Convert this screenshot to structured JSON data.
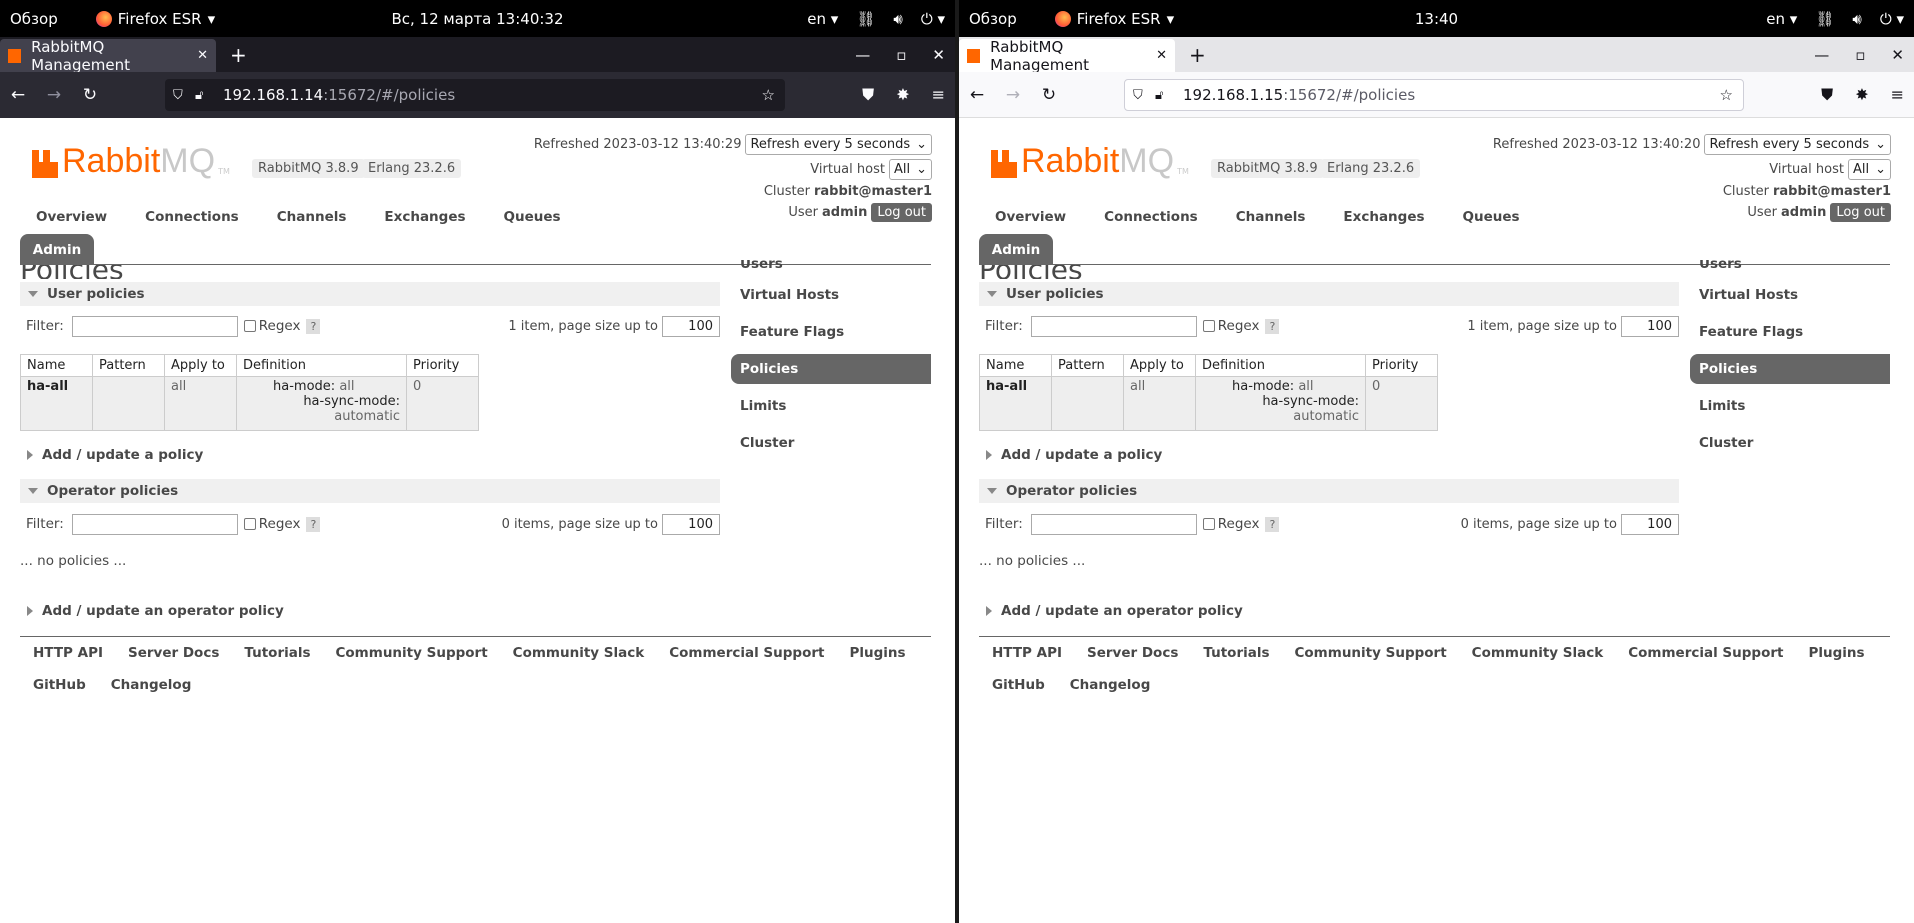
{
  "windows": [
    {
      "gnome": {
        "activities": "Обзор",
        "app": "Firefox ESR",
        "clock": "Вс, 12 марта  13:40:32",
        "lang": "en"
      },
      "tab_title": "RabbitMQ Management",
      "url_host": "192.168.1.14",
      "url_path": ":15672/#/policies",
      "refreshed": "Refreshed 2023-03-12 13:40:29",
      "refresh_option": "Refresh every 5 seconds",
      "vhost_label": "Virtual host",
      "vhost_value": "All",
      "cluster_label": "Cluster",
      "cluster_value": "rabbit@master1",
      "user_label": "User",
      "user_value": "admin",
      "logout": "Log out",
      "version": "RabbitMQ 3.8.9",
      "erlang": "Erlang 23.2.6"
    },
    {
      "gnome": {
        "activities": "Обзор",
        "app": "Firefox ESR",
        "clock": "13:40",
        "lang": "en"
      },
      "tab_title": "RabbitMQ Management",
      "url_host": "192.168.1.15",
      "url_path": ":15672/#/policies",
      "refreshed": "Refreshed 2023-03-12 13:40:20",
      "refresh_option": "Refresh every 5 seconds",
      "vhost_label": "Virtual host",
      "vhost_value": "All",
      "cluster_label": "Cluster",
      "cluster_value": "rabbit@master1",
      "user_label": "User",
      "user_value": "admin",
      "logout": "Log out",
      "version": "RabbitMQ 3.8.9",
      "erlang": "Erlang 23.2.6"
    }
  ],
  "logo": {
    "rabbit": "Rabbit",
    "mq": "MQ",
    "tm": "TM"
  },
  "nav": [
    "Overview",
    "Connections",
    "Channels",
    "Exchanges",
    "Queues"
  ],
  "admin_tab": "Admin",
  "page_title": "Policies",
  "sidebar": {
    "clipped": "Users",
    "items": [
      "Virtual Hosts",
      "Feature Flags",
      "Policies",
      "Limits",
      "Cluster"
    ],
    "active": "Policies"
  },
  "user_policies": {
    "title": "User policies",
    "filter_label": "Filter:",
    "regex": "Regex",
    "help": "?",
    "count_text": "1 item, page size up to",
    "page_size": "100",
    "columns": [
      "Name",
      "Pattern",
      "Apply to",
      "Definition",
      "Priority"
    ],
    "rows": [
      {
        "name": "ha-all",
        "pattern": "",
        "apply_to": "all",
        "def_k1": "ha-mode:",
        "def_v1": "all",
        "def_k2": "ha-sync-mode:",
        "def_v2": "automatic",
        "priority": "0"
      }
    ],
    "add": "Add / update a policy"
  },
  "operator_policies": {
    "title": "Operator policies",
    "filter_label": "Filter:",
    "regex": "Regex",
    "help": "?",
    "count_text": "0 items, page size up to",
    "page_size": "100",
    "empty": "... no policies ...",
    "add": "Add / update an operator policy"
  },
  "footer": [
    "HTTP API",
    "Server Docs",
    "Tutorials",
    "Community Support",
    "Community Slack",
    "Commercial Support",
    "Plugins",
    "GitHub",
    "Changelog"
  ],
  "colors": {
    "brand": "#ff6600",
    "active_tab": "#666666",
    "dark_chrome": "#2b2a33",
    "light_chrome": "#f9f9fb"
  }
}
